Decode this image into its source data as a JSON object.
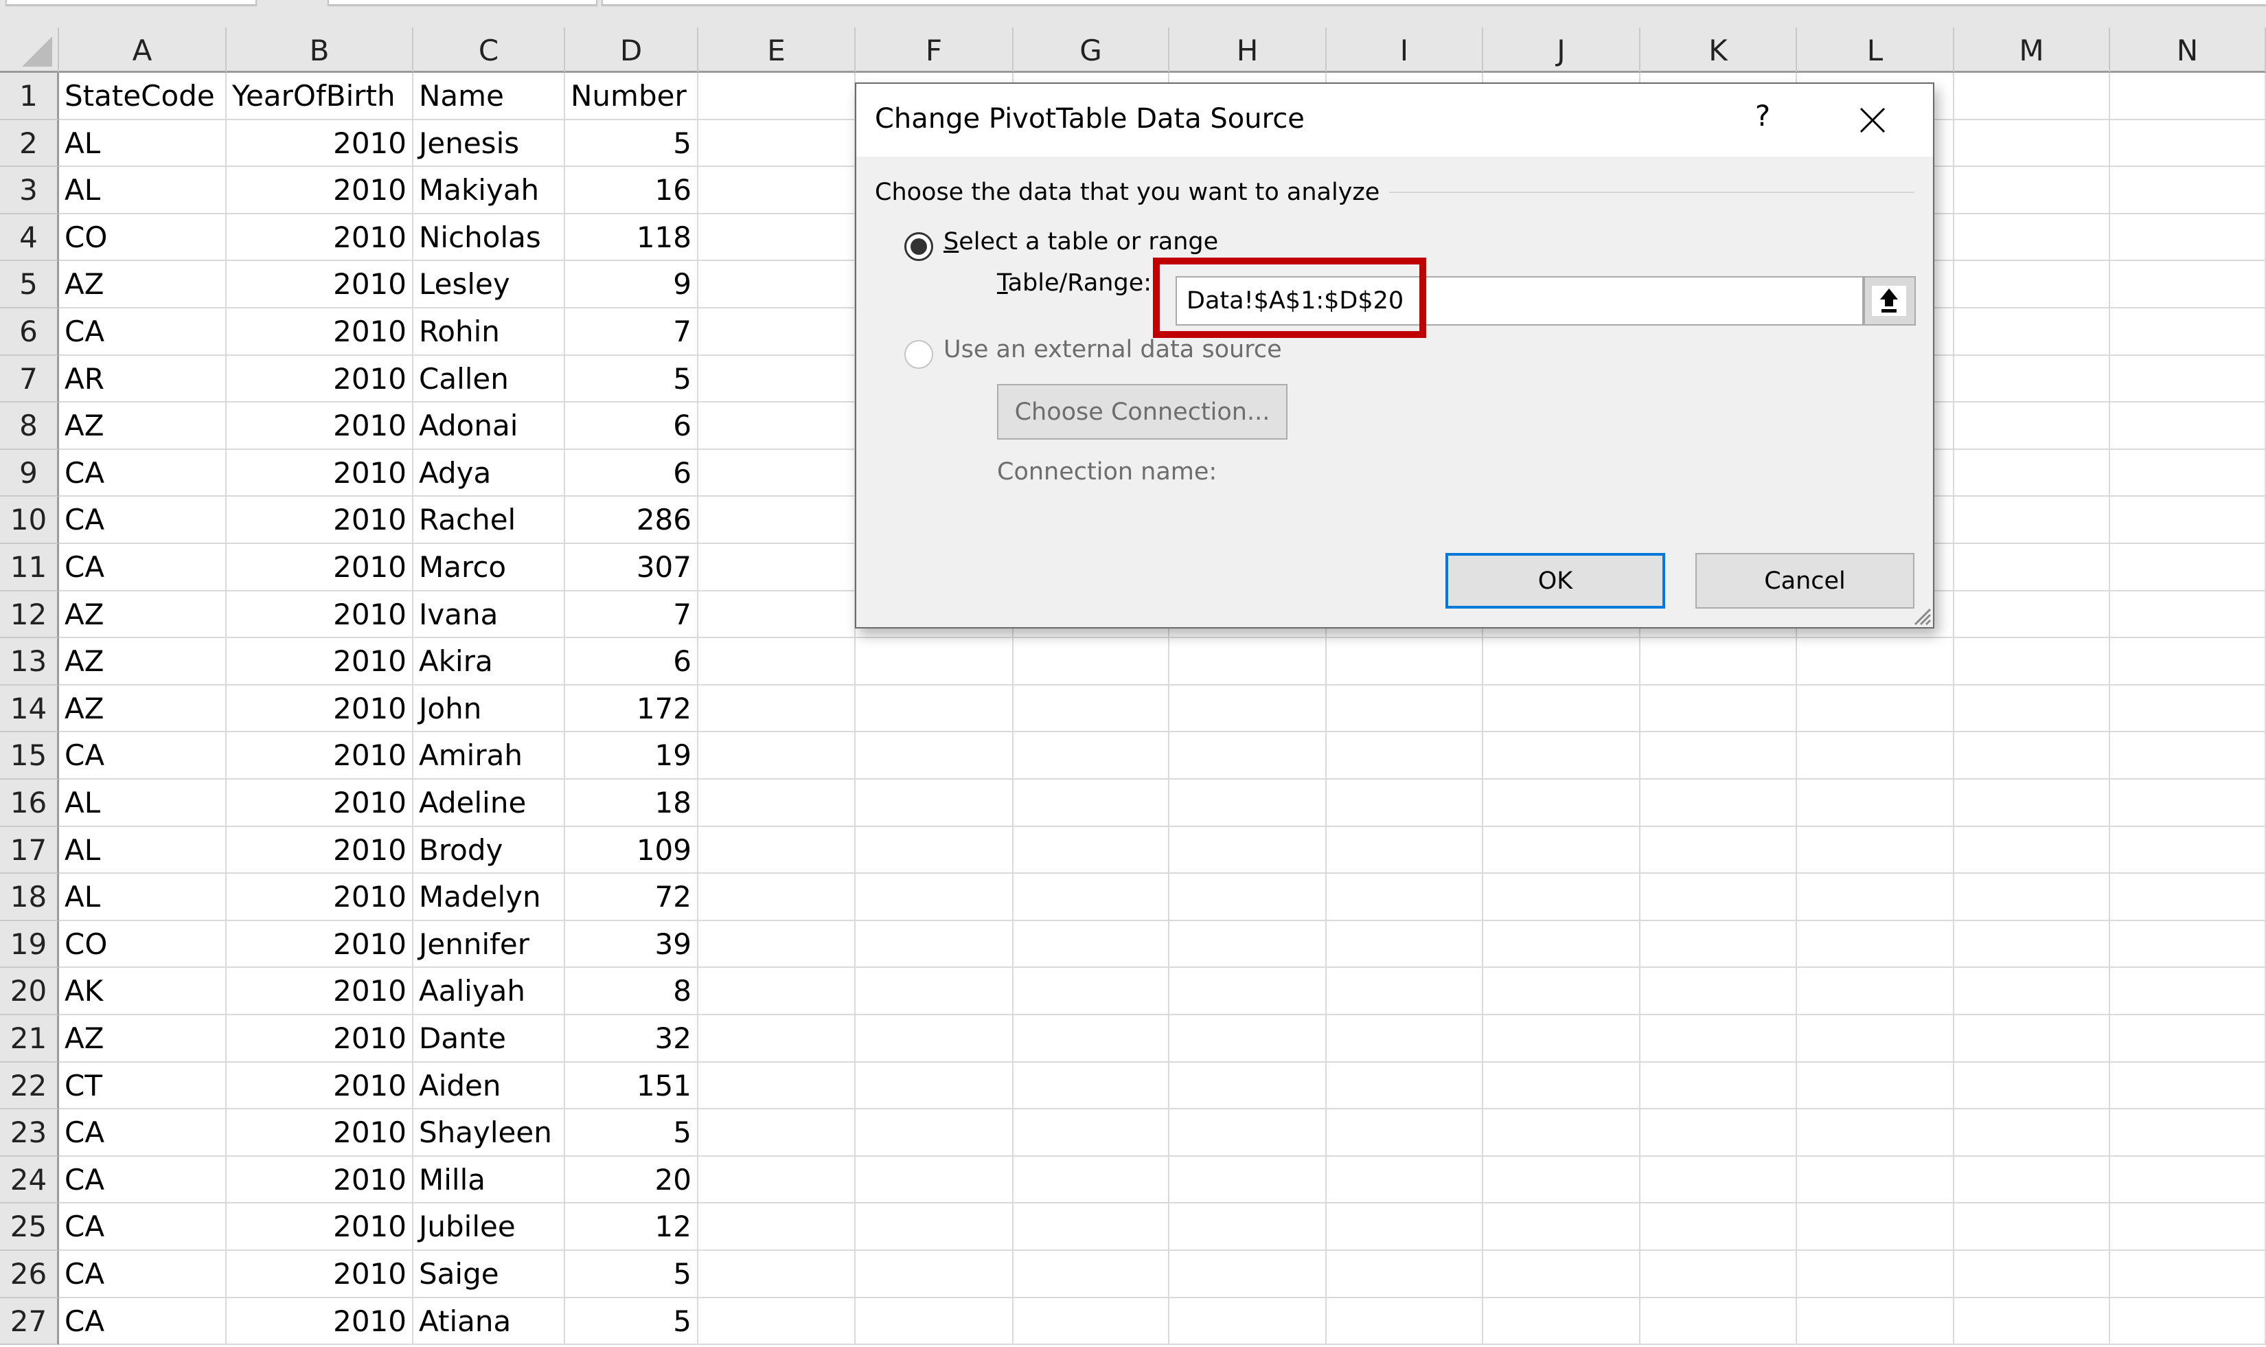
{
  "spreadsheet": {
    "columns": [
      "A",
      "B",
      "C",
      "D",
      "E",
      "F",
      "G",
      "H",
      "I",
      "J",
      "K",
      "L",
      "M",
      "N"
    ],
    "header_row": [
      "StateCode",
      "YearOfBirth",
      "Name",
      "Number"
    ],
    "rows": [
      [
        "AL",
        "2010",
        "Jenesis",
        "5"
      ],
      [
        "AL",
        "2010",
        "Makiyah",
        "16"
      ],
      [
        "CO",
        "2010",
        "Nicholas",
        "118"
      ],
      [
        "AZ",
        "2010",
        "Lesley",
        "9"
      ],
      [
        "CA",
        "2010",
        "Rohin",
        "7"
      ],
      [
        "AR",
        "2010",
        "Callen",
        "5"
      ],
      [
        "AZ",
        "2010",
        "Adonai",
        "6"
      ],
      [
        "CA",
        "2010",
        "Adya",
        "6"
      ],
      [
        "CA",
        "2010",
        "Rachel",
        "286"
      ],
      [
        "CA",
        "2010",
        "Marco",
        "307"
      ],
      [
        "AZ",
        "2010",
        "Ivana",
        "7"
      ],
      [
        "AZ",
        "2010",
        "Akira",
        "6"
      ],
      [
        "AZ",
        "2010",
        "John",
        "172"
      ],
      [
        "CA",
        "2010",
        "Amirah",
        "19"
      ],
      [
        "AL",
        "2010",
        "Adeline",
        "18"
      ],
      [
        "AL",
        "2010",
        "Brody",
        "109"
      ],
      [
        "AL",
        "2010",
        "Madelyn",
        "72"
      ],
      [
        "CO",
        "2010",
        "Jennifer",
        "39"
      ],
      [
        "AK",
        "2010",
        "Aaliyah",
        "8"
      ],
      [
        "AZ",
        "2010",
        "Dante",
        "32"
      ],
      [
        "CT",
        "2010",
        "Aiden",
        "151"
      ],
      [
        "CA",
        "2010",
        "Shayleen",
        "5"
      ],
      [
        "CA",
        "2010",
        "Milla",
        "20"
      ],
      [
        "CA",
        "2010",
        "Jubilee",
        "12"
      ],
      [
        "CA",
        "2010",
        "Saige",
        "5"
      ],
      [
        "CA",
        "2010",
        "Atiana",
        "5"
      ]
    ]
  },
  "dialog": {
    "title": "Change PivotTable Data Source",
    "help_label": "?",
    "close_icon": "close-icon",
    "group_label": "Choose the data that you want to analyze",
    "option_table": {
      "label_accel": "S",
      "label_rest": "elect a table or range",
      "selected": true
    },
    "table_range": {
      "label_accel": "T",
      "label_rest": "able/Range:",
      "value": "Data!$A$1:$D$20",
      "collapse_icon": "collapse-dialog-icon"
    },
    "option_external": {
      "label": "Use an external data source",
      "selected": false,
      "enabled": false
    },
    "choose_connection_label": "Choose Connection...",
    "connection_name_label": "Connection name:",
    "ok_label": "OK",
    "cancel_label": "Cancel",
    "highlight_color": "#C00000",
    "default_button_color": "#0078D7"
  }
}
